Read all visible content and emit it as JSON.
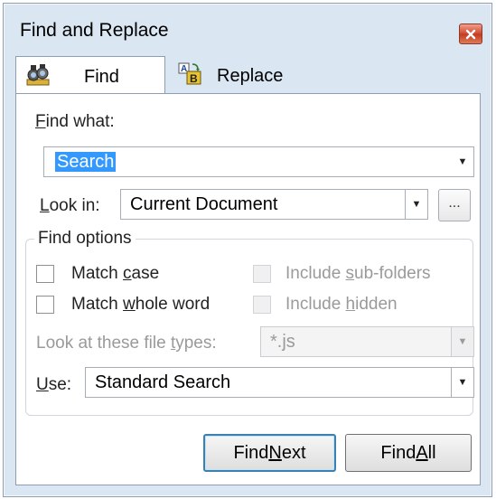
{
  "window": {
    "title": "Find and Replace"
  },
  "tabs": [
    {
      "label": "Find",
      "icon": "binoculars-icon"
    },
    {
      "label": "Replace",
      "icon": "replace-icon"
    }
  ],
  "find_what": {
    "label_ul": "F",
    "label_rest": "ind what:",
    "value": "Search"
  },
  "look_in": {
    "label_ul": "L",
    "label_rest": "ook in:",
    "value": "Current Document",
    "browse_label": "..."
  },
  "options": {
    "title": "Find options",
    "match_case": {
      "pre": "Match ",
      "ul": "c",
      "post": "ase",
      "checked": false
    },
    "match_whole_word": {
      "pre": "Match ",
      "ul": "w",
      "post": "hole word",
      "checked": false
    },
    "include_subfolders": {
      "pre": "Include ",
      "ul": "s",
      "post": "ub-folders",
      "enabled": false
    },
    "include_hidden": {
      "pre": "Include ",
      "ul": "h",
      "post": "idden",
      "enabled": false
    },
    "file_types": {
      "pre": "Look at these file ",
      "ul": "t",
      "post": "ypes:",
      "value": "*.js",
      "enabled": false
    },
    "use": {
      "label_ul": "U",
      "label_rest": "se:",
      "value": "Standard Search"
    }
  },
  "buttons": {
    "find_next": {
      "pre": "Find ",
      "ul": "N",
      "post": "ext"
    },
    "find_all": {
      "pre": "Find ",
      "ul": "A",
      "post": "ll"
    }
  },
  "colors": {
    "selection": "#3399ff",
    "close": "#c23a20",
    "chrome": "#dbe6f3"
  }
}
